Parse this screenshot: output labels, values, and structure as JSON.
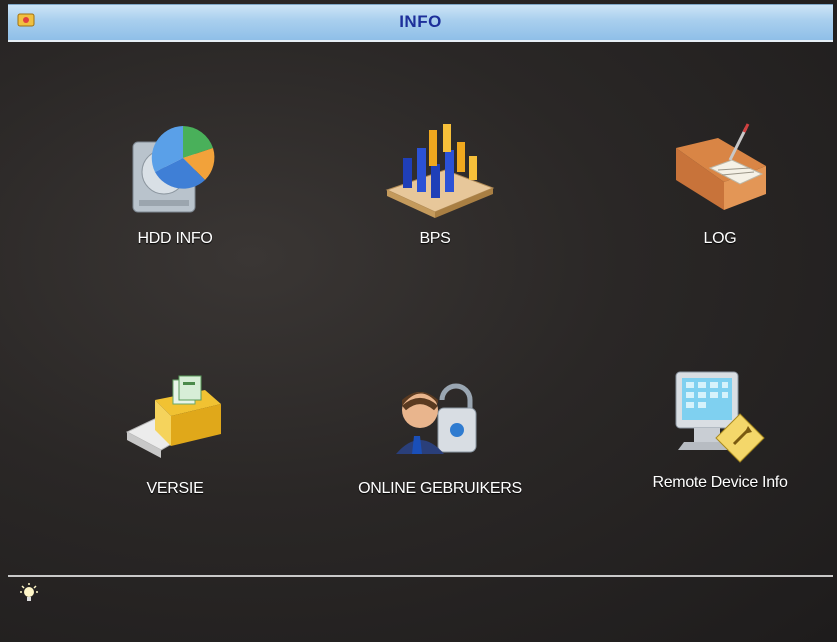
{
  "window": {
    "title": "INFO",
    "icon": "app-window-icon"
  },
  "items": [
    {
      "label": "HDD INFO",
      "icon": "hdd-pie-chart-icon"
    },
    {
      "label": "BPS",
      "icon": "bar-chart-icon"
    },
    {
      "label": "LOG",
      "icon": "log-book-icon"
    },
    {
      "label": "VERSIE",
      "icon": "version-box-icon"
    },
    {
      "label": "ONLINE GEBRUIKERS",
      "icon": "online-users-icon"
    },
    {
      "label": "Remote Device Info",
      "icon": "remote-device-monitor-icon"
    }
  ],
  "footer": {
    "icon": "light-bulb-icon"
  }
}
